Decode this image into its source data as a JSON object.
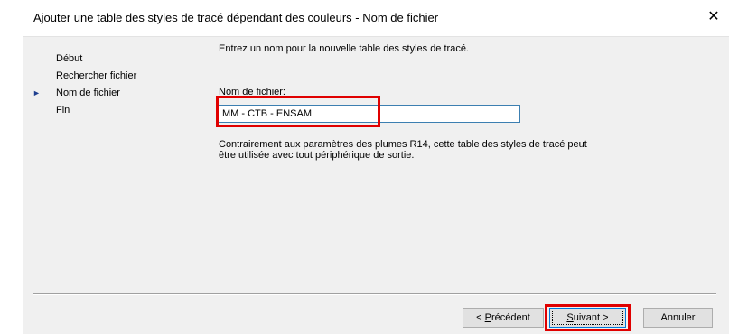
{
  "window": {
    "title": "Ajouter une table des styles de tracé dépendant des couleurs - Nom de fichier",
    "close_glyph": "✕"
  },
  "steps": [
    {
      "label": "Début",
      "current": false
    },
    {
      "label": "Rechercher fichier",
      "current": false
    },
    {
      "label": "Nom de fichier",
      "current": true
    },
    {
      "label": "Fin",
      "current": false
    }
  ],
  "current_step_marker": "►",
  "content": {
    "instruction": "Entrez un nom pour la nouvelle table des styles de tracé.",
    "field_label": "Nom de fichier:",
    "filename_value": "MM - CTB - ENSAM",
    "note_line1": "Contrairement aux paramètres des plumes R14, cette table des styles de tracé peut",
    "note_line2": "être utilisée avec tout périphérique de sortie."
  },
  "buttons": {
    "prev_mnemonic": "P",
    "prev_rest": "récédent",
    "prev_prefix": "< ",
    "next_mnemonic": "S",
    "next_rest": "uivant >",
    "cancel": "Annuler"
  },
  "colors": {
    "highlight": "#e00000",
    "focus_border": "#0078d7",
    "dialog_bg": "#f0f0f0"
  }
}
